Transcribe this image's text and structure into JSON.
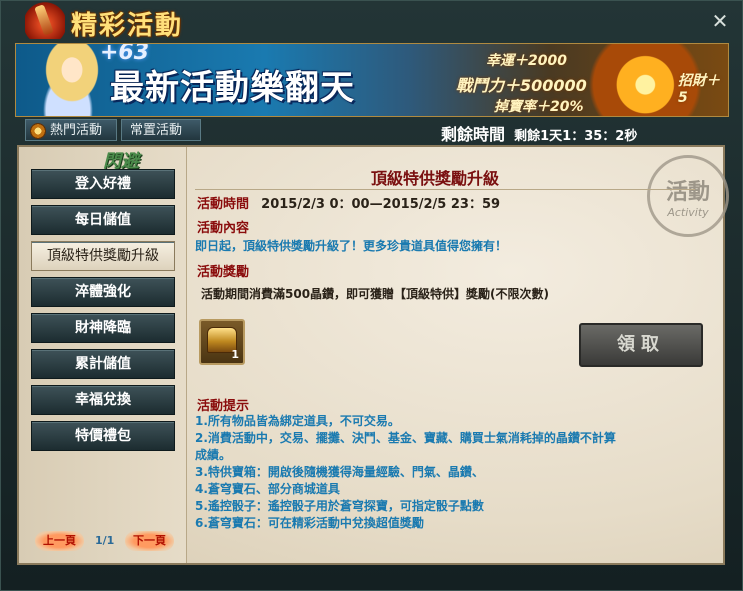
{
  "window": {
    "title": "精彩活動",
    "close_glyph": "✕"
  },
  "banner": {
    "plus": "+63",
    "title": "最新活動樂翻天",
    "stats": {
      "luck": "幸運＋2000",
      "power": "戰鬥力＋500000",
      "drop": "掉寶率＋20%",
      "recruit": "招財＋5"
    }
  },
  "tabs": {
    "hot": "熱門活動",
    "regular": "常置活動"
  },
  "countdown": {
    "label": "剩餘時間",
    "value": "剩餘1天1：35：2秒"
  },
  "sidebar": {
    "tag": "閃避",
    "items": [
      {
        "label": "登入好禮"
      },
      {
        "label": "每日儲值"
      },
      {
        "label": "頂級特供獎勵升級"
      },
      {
        "label": "淬體強化"
      },
      {
        "label": "財神降臨"
      },
      {
        "label": "累計儲值"
      },
      {
        "label": "幸福兌換"
      },
      {
        "label": "特價禮包"
      }
    ],
    "pager": {
      "prev": "上一頁",
      "page": "1/1",
      "next": "下一頁"
    }
  },
  "activity": {
    "title": "頂級特供獎勵升級",
    "time_label": "活動時間",
    "time_value": "2015/2/3 0：00—2015/2/5 23：59",
    "content_label": "活動內容",
    "content": "即日起，頂級特供獎勵升級了！更多珍貴道具值得您擁有！",
    "reward_label": "活動獎勵",
    "reward_text": "活動期間消費滿500晶鑽，即可獲贈【頂級特供】獎勵(不限次數)",
    "reward_qty": "1",
    "claim_label": "領取",
    "tips_label": "活動提示",
    "tips": [
      "1.所有物品皆為綁定道具，不可交易。",
      "2.消費活動中，交易、擺攤、決鬥、基金、寶藏、購買士氣消耗掉的晶鑽不計算",
      "成績。",
      "3.特供寶箱：開啟後隨機獲得海量經驗、門氣、晶鑽、",
      "4.蒼穹寶石、部分商城道具",
      "5.遙控骰子：遙控骰子用於蒼穹探寶，可指定骰子點數",
      "6.蒼穹寶石：可在精彩活動中兌換超值獎勵"
    ]
  },
  "stamp": {
    "cn": "活動",
    "en": "Activity"
  }
}
